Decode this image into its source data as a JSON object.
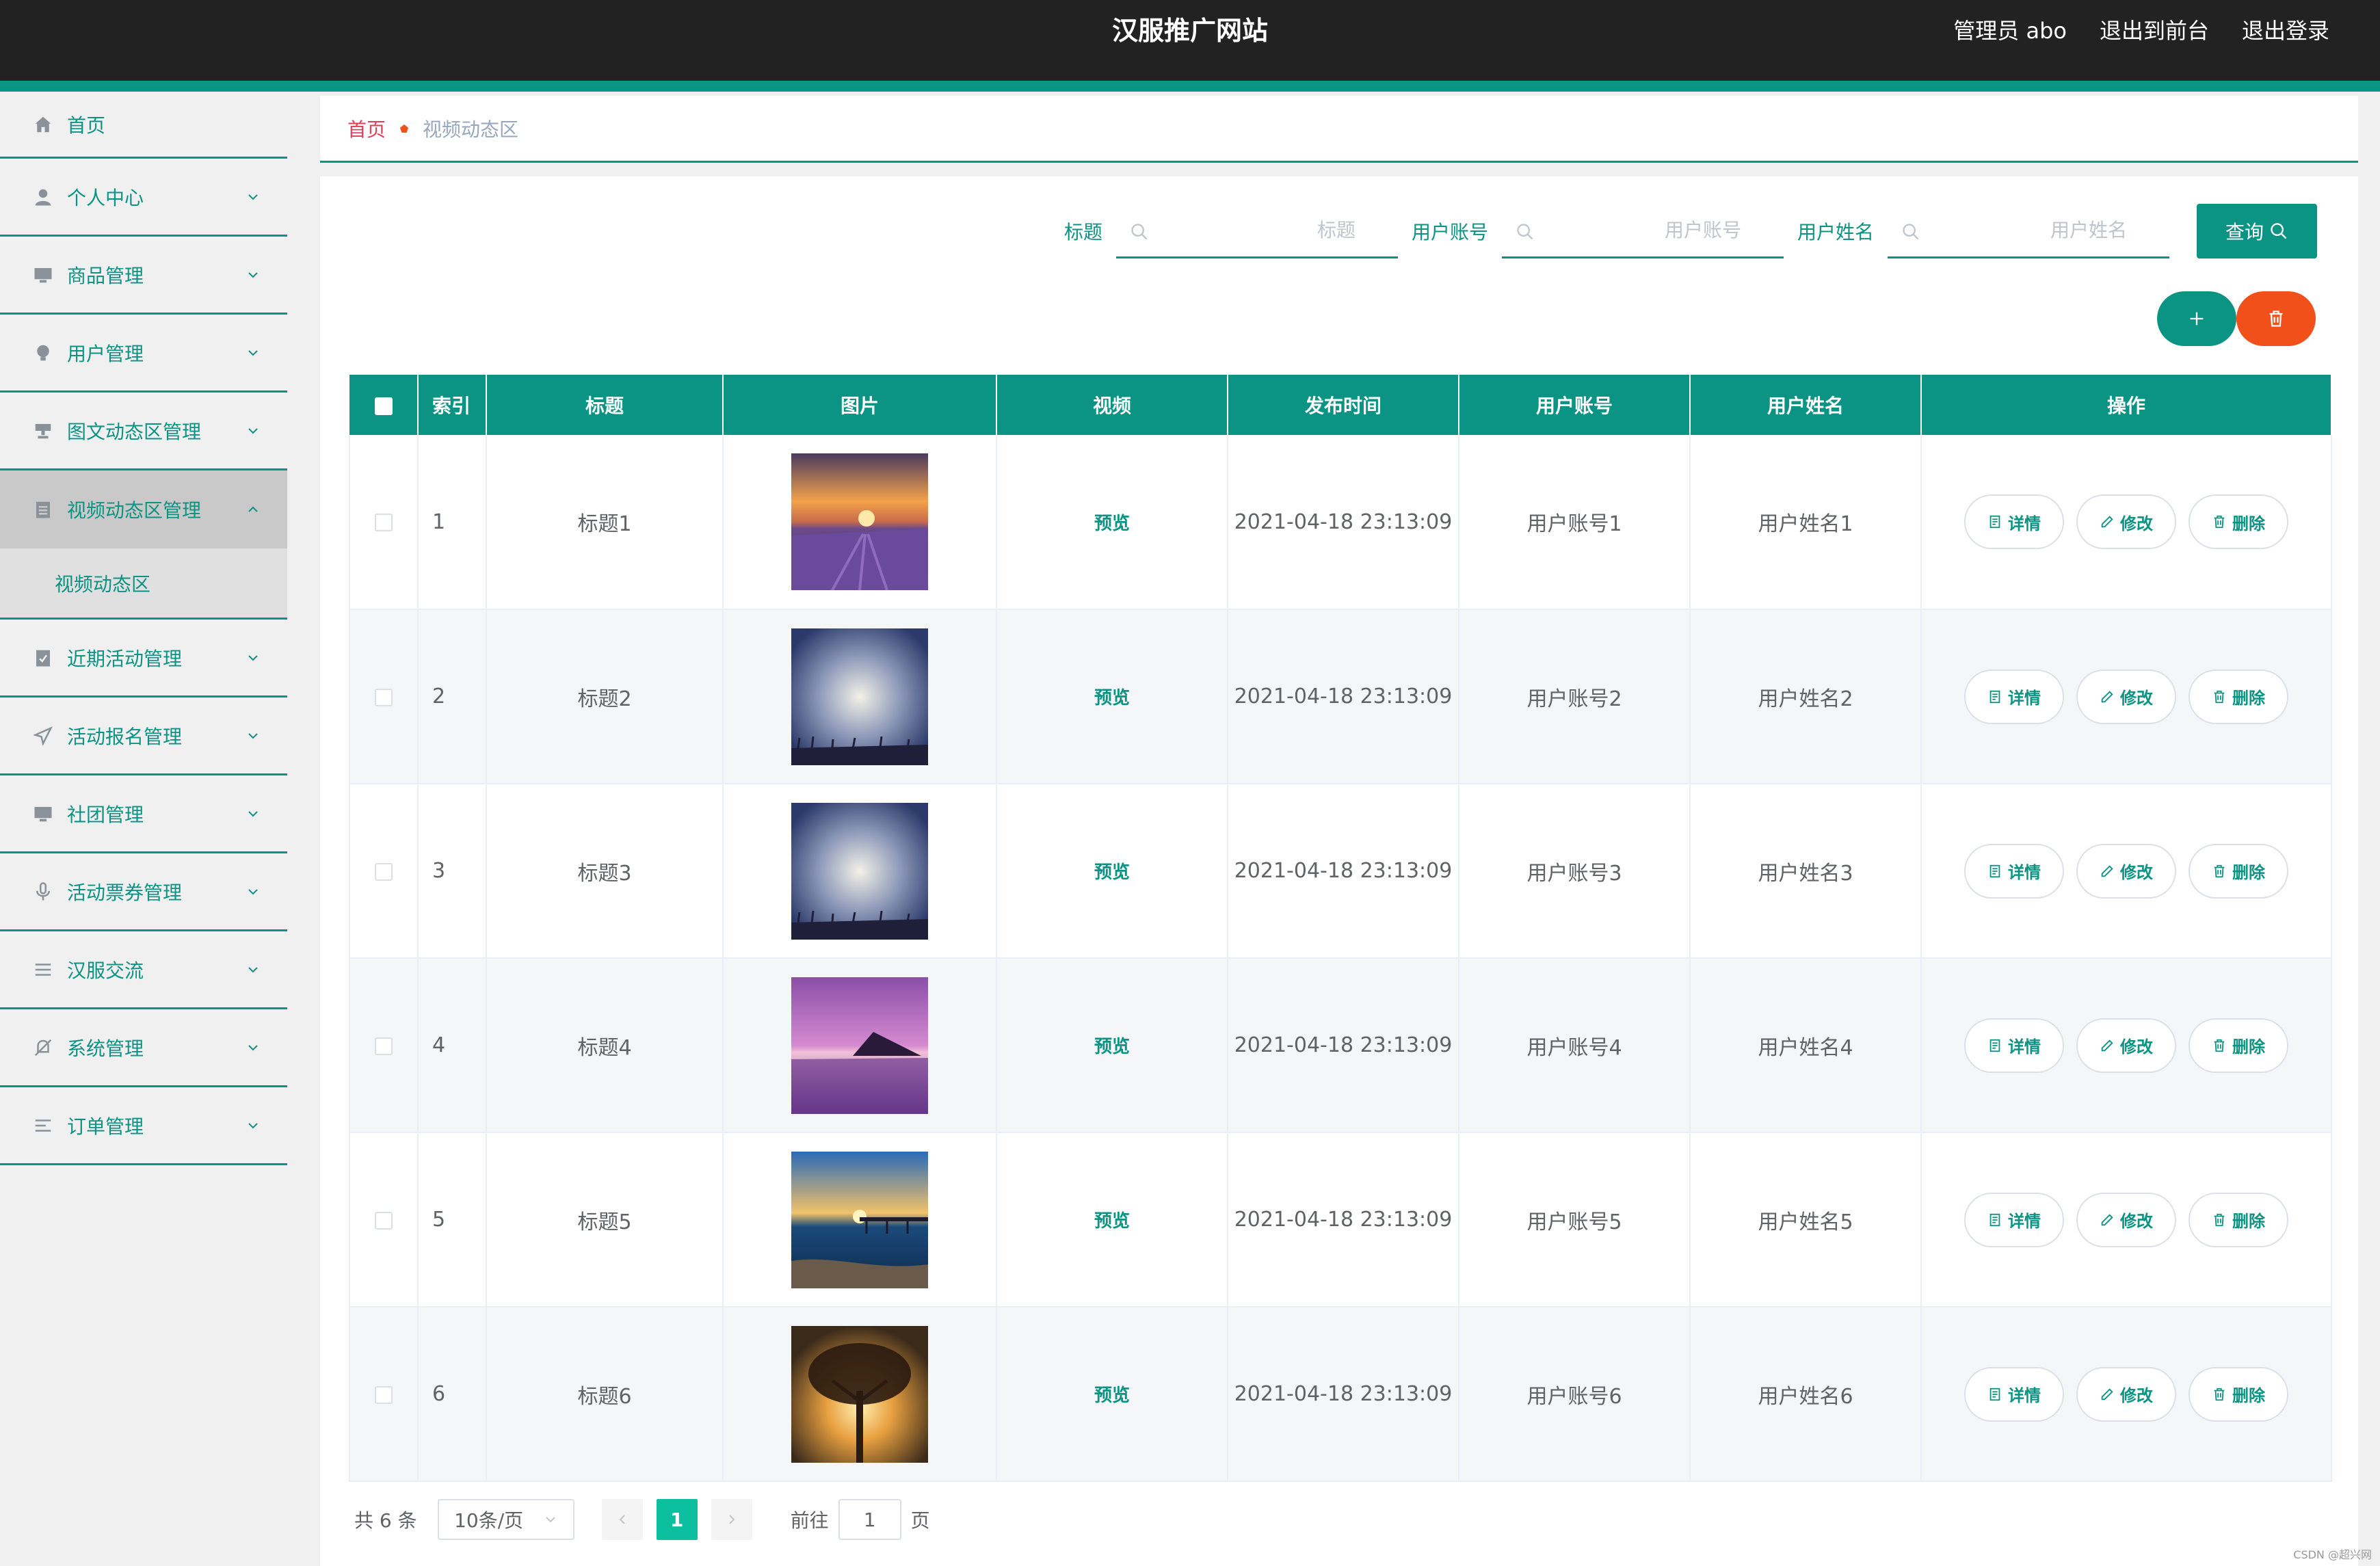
{
  "header": {
    "title": "汉服推广网站",
    "admin": "管理员 abo",
    "to_front": "退出到前台",
    "logout": "退出登录"
  },
  "sidebar": {
    "items": [
      {
        "label": "首页",
        "icon": "home-icon"
      },
      {
        "label": "个人中心",
        "icon": "user-icon"
      },
      {
        "label": "商品管理",
        "icon": "monitor-icon"
      },
      {
        "label": "用户管理",
        "icon": "bulb-icon"
      },
      {
        "label": "图文动态区管理",
        "icon": "stamp-icon"
      },
      {
        "label": "视频动态区管理",
        "icon": "clipboard-icon"
      },
      {
        "label": "近期活动管理",
        "icon": "checklist-icon"
      },
      {
        "label": "活动报名管理",
        "icon": "send-icon"
      },
      {
        "label": "社团管理",
        "icon": "monitor-icon"
      },
      {
        "label": "活动票券管理",
        "icon": "microphone-icon"
      },
      {
        "label": "汉服交流",
        "icon": "list-icon"
      },
      {
        "label": "系统管理",
        "icon": "bell-off-icon"
      },
      {
        "label": "订单管理",
        "icon": "menu-lines-icon"
      }
    ],
    "submenu": "视频动态区"
  },
  "breadcrumb": {
    "home": "首页",
    "current": "视频动态区"
  },
  "search": {
    "title_label": "标题",
    "title_placeholder": "标题",
    "account_label": "用户账号",
    "account_placeholder": "用户账号",
    "name_label": "用户姓名",
    "name_placeholder": "用户姓名",
    "query_button": "查询"
  },
  "table": {
    "headers": [
      "",
      "索引",
      "标题",
      "图片",
      "视频",
      "发布时间",
      "用户账号",
      "用户姓名",
      "操作"
    ],
    "preview_label": "预览",
    "detail_label": "详情",
    "edit_label": "修改",
    "delete_label": "删除",
    "rows": [
      {
        "index": "1",
        "title": "标题1",
        "image": "lavender-sunset",
        "time": "2021-04-18 23:13:09",
        "account": "用户账号1",
        "name": "用户姓名1"
      },
      {
        "index": "2",
        "title": "标题2",
        "image": "blue-sky-field",
        "time": "2021-04-18 23:13:09",
        "account": "用户账号2",
        "name": "用户姓名2"
      },
      {
        "index": "3",
        "title": "标题3",
        "image": "blue-sky-field",
        "time": "2021-04-18 23:13:09",
        "account": "用户账号3",
        "name": "用户姓名3"
      },
      {
        "index": "4",
        "title": "标题4",
        "image": "purple-sea-island",
        "time": "2021-04-18 23:13:09",
        "account": "用户账号4",
        "name": "用户姓名4"
      },
      {
        "index": "5",
        "title": "标题5",
        "image": "pier-sunset",
        "time": "2021-04-18 23:13:09",
        "account": "用户账号5",
        "name": "用户姓名5"
      },
      {
        "index": "6",
        "title": "标题6",
        "image": "tree-sunset",
        "time": "2021-04-18 23:13:09",
        "account": "用户账号6",
        "name": "用户姓名6"
      }
    ]
  },
  "pagination": {
    "total": "共 6 条",
    "page_size": "10条/页",
    "current_page": "1",
    "goto_label": "前往",
    "goto_value": "1",
    "page_unit": "页"
  },
  "watermark": "CSDN @超兴网",
  "colors": {
    "accent": "#0b9384",
    "danger": "#f2501a",
    "topbar": "#222222",
    "breadcrumb_home": "#e33e57"
  }
}
